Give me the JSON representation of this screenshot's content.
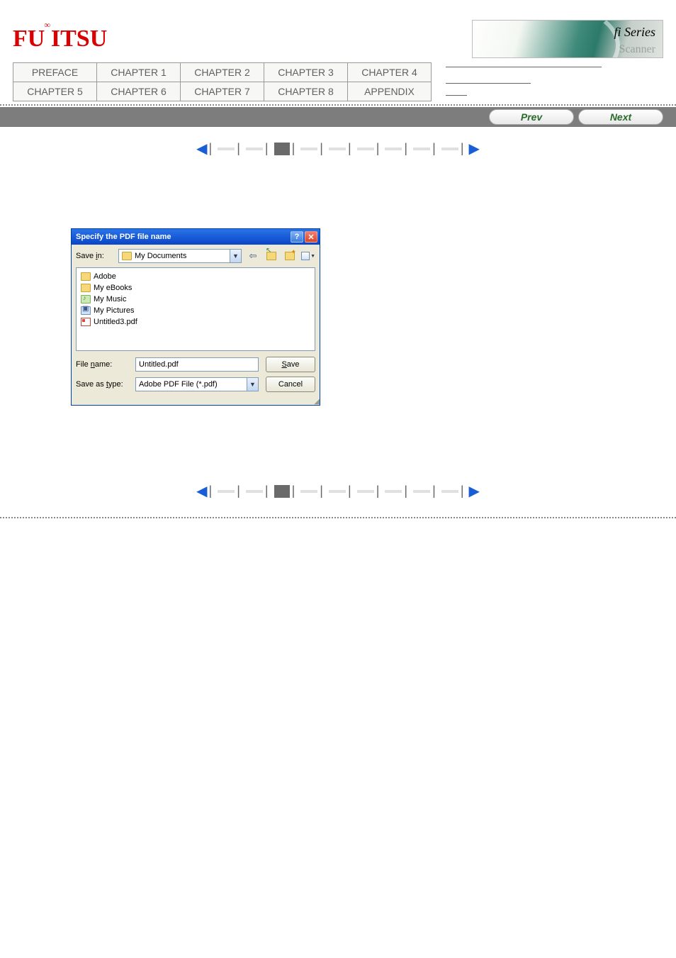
{
  "logo": {
    "text": "FUJITSU",
    "infinity": "∞"
  },
  "banner": {
    "fi": "fi Series",
    "scanner": "Scanner"
  },
  "nav": {
    "row1": [
      "PREFACE",
      "CHAPTER 1",
      "CHAPTER 2",
      "CHAPTER 3",
      "CHAPTER 4"
    ],
    "row2": [
      "CHAPTER 5",
      "CHAPTER 6",
      "CHAPTER 7",
      "CHAPTER 8",
      "APPENDIX"
    ]
  },
  "navButtons": {
    "prev": "Prev",
    "next": "Next"
  },
  "dialog": {
    "title": "Specify the PDF file name",
    "saveInLabelPre": "Save ",
    "saveInLabelU": "i",
    "saveInLabelPost": "n:",
    "saveInValue": "My Documents",
    "items": [
      {
        "icon": "folder",
        "name": "Adobe"
      },
      {
        "icon": "folder",
        "name": "My eBooks"
      },
      {
        "icon": "folder-green",
        "name": "My Music"
      },
      {
        "icon": "folder-pic",
        "name": "My Pictures"
      },
      {
        "icon": "pdf",
        "name": "Untitled3.pdf"
      }
    ],
    "fileNameLabelPre": "File ",
    "fileNameLabelU": "n",
    "fileNameLabelPost": "ame:",
    "fileNameValue": "Untitled.pdf",
    "saveTypeLabelPre": "Save as ",
    "saveTypeLabelU": "t",
    "saveTypeLabelPost": "ype:",
    "saveTypeValue": "Adobe PDF File (*.pdf)",
    "saveBtnU": "S",
    "saveBtnRest": "ave",
    "cancelBtn": "Cancel"
  }
}
